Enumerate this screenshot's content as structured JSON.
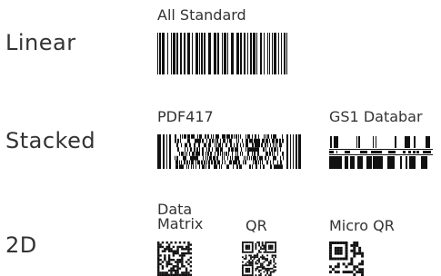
{
  "categories": {
    "linear": "Linear",
    "stacked": "Stacked",
    "two_d": "2D"
  },
  "symbologies": {
    "all_standard": {
      "label": "All Standard",
      "icon": "linear-barcode-icon"
    },
    "pdf417": {
      "label": "PDF417",
      "icon": "pdf417-barcode-icon"
    },
    "gs1_databar": {
      "label": "GS1 Databar",
      "icon": "gs1-databar-barcode-icon"
    },
    "data_matrix": {
      "label": "Data\nMatrix",
      "icon": "data-matrix-code-icon"
    },
    "qr": {
      "label": "QR",
      "icon": "qr-code-icon"
    },
    "micro_qr": {
      "label": "Micro QR",
      "icon": "micro-qr-code-icon"
    }
  },
  "colors": {
    "ink": "#111111",
    "text": "#333333",
    "background": "#ffffff"
  }
}
